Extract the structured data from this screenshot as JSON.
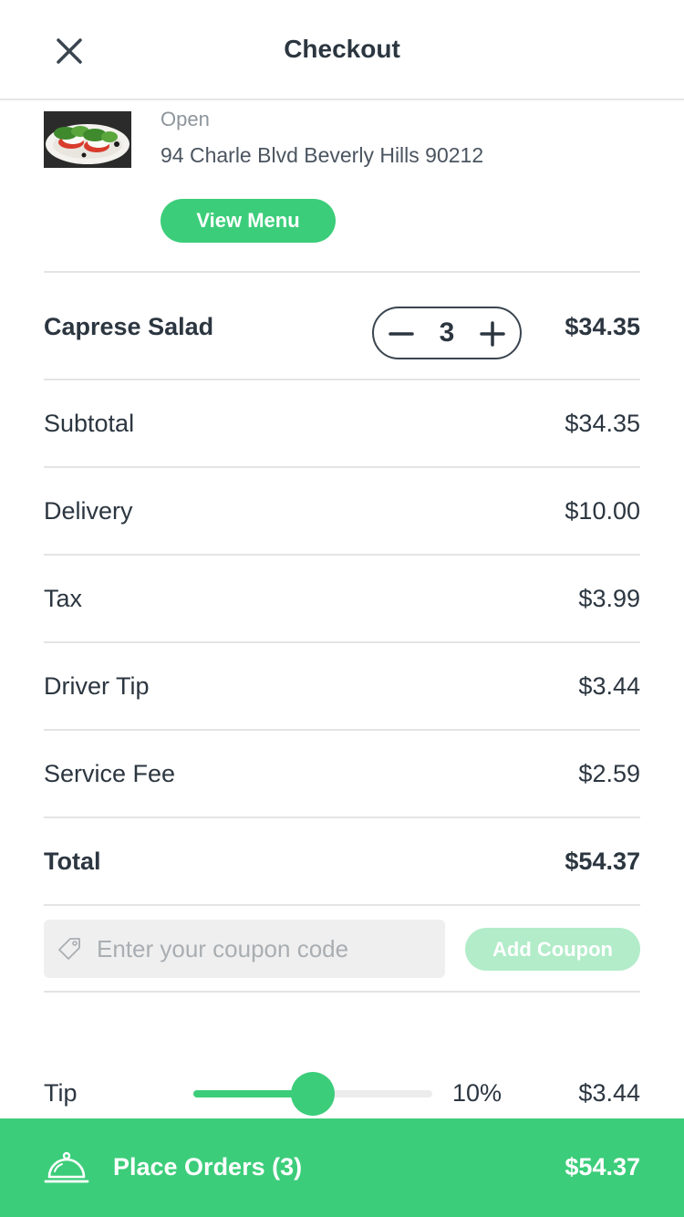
{
  "header": {
    "title": "Checkout"
  },
  "restaurant": {
    "status": "Open",
    "address": "94 Charle Blvd Beverly Hills 90212",
    "view_menu_label": "View Menu"
  },
  "cart": {
    "items": [
      {
        "name": "Caprese Salad",
        "quantity": "3",
        "price": "$34.35"
      }
    ]
  },
  "summary": {
    "subtotal": {
      "label": "Subtotal",
      "value": "$34.35"
    },
    "delivery": {
      "label": "Delivery",
      "value": "$10.00"
    },
    "tax": {
      "label": "Tax",
      "value": "$3.99"
    },
    "driver_tip": {
      "label": "Driver Tip",
      "value": "$3.44"
    },
    "service_fee": {
      "label": "Service Fee",
      "value": "$2.59"
    },
    "total": {
      "label": "Total",
      "value": "$54.37"
    }
  },
  "coupon": {
    "placeholder": "Enter your coupon code",
    "value": "",
    "button_label": "Add Coupon"
  },
  "tip": {
    "label": "Tip",
    "percent_label": "10%",
    "amount": "$3.44",
    "slider_level": 0.5
  },
  "footer": {
    "label": "Place Orders (3)",
    "total": "$54.37"
  },
  "colors": {
    "accent": "#3ccd7a",
    "accent_light": "#b2ecc9",
    "text": "#2c3640",
    "muted": "#8d959c"
  }
}
